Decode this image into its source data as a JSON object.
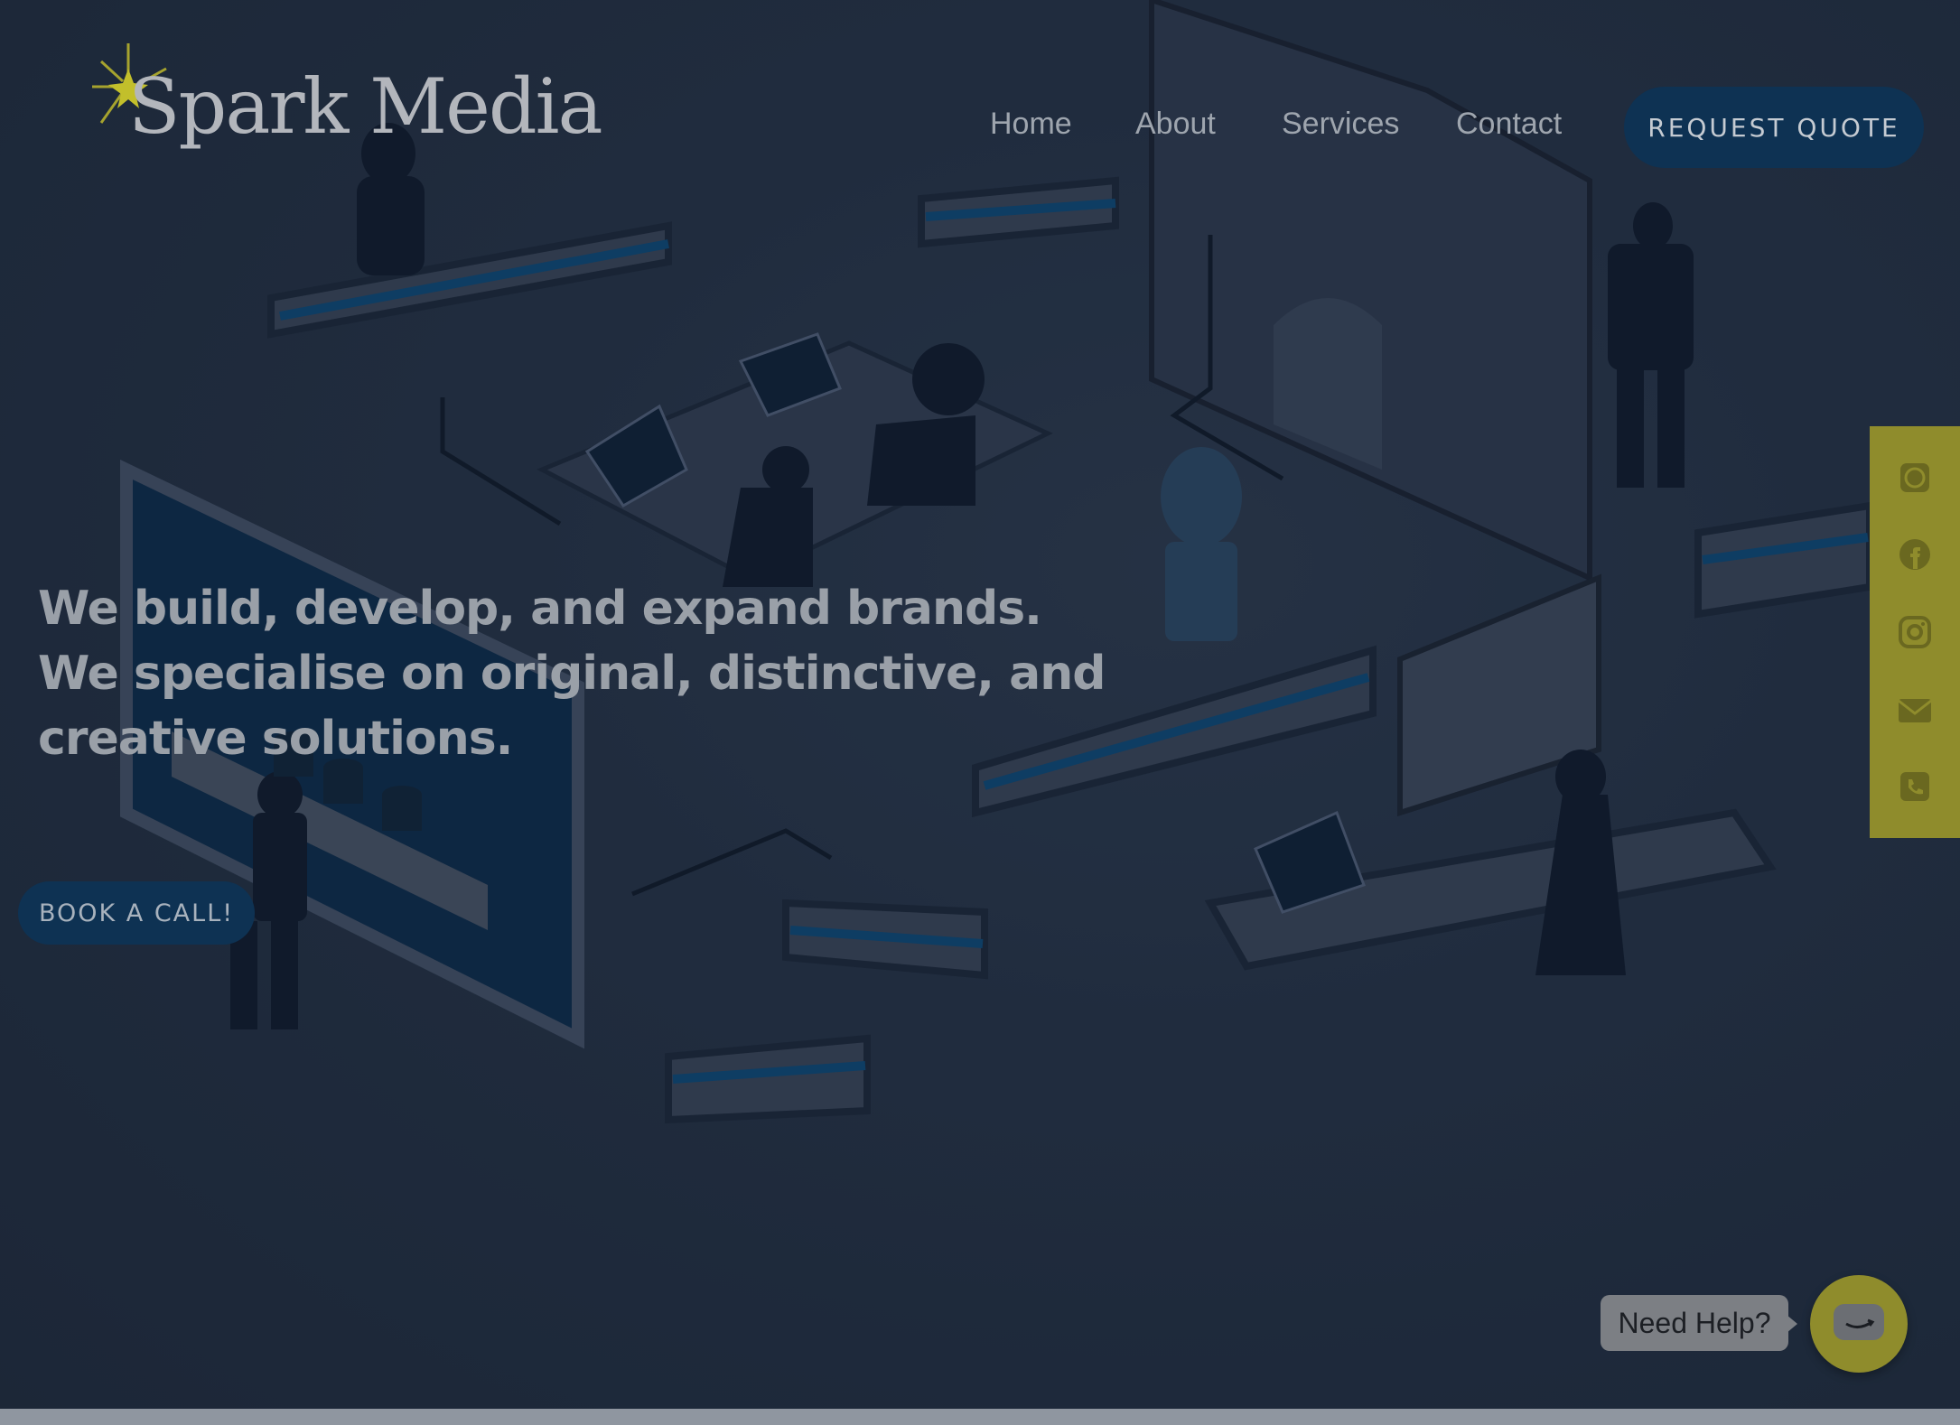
{
  "brand": {
    "name": "Spark Media",
    "accent": "#8f8c2c",
    "primary": "#0e3253"
  },
  "nav": {
    "items": [
      {
        "label": "Home"
      },
      {
        "label": "About"
      },
      {
        "label": "Services"
      },
      {
        "label": "Contact"
      }
    ],
    "cta_label": "REQUEST QUOTE"
  },
  "hero": {
    "headline": "We build, develop, and expand brands. We specialise on original, distinctive, and creative solutions.",
    "cta_label": "BOOK A CALL!",
    "illustration": "isometric-office-illustration"
  },
  "social_bar": {
    "icons": [
      "whatsapp-icon",
      "facebook-icon",
      "instagram-icon",
      "email-icon",
      "phone-icon"
    ]
  },
  "chat": {
    "prompt": "Need Help?",
    "icon": "chat-icon"
  }
}
